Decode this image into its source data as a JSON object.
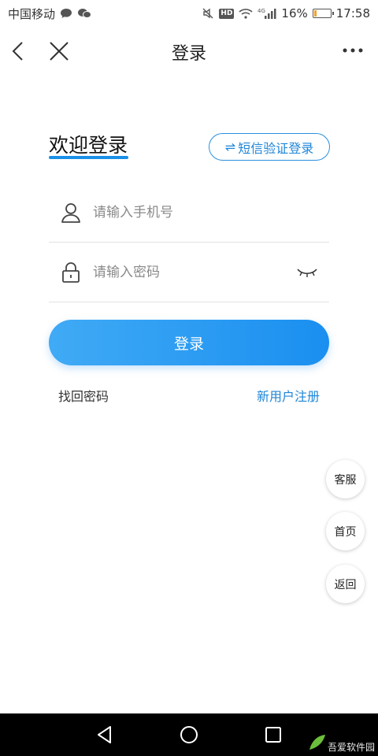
{
  "status_bar": {
    "carrier": "中国移动",
    "icons": [
      "chat-bubble-icon",
      "wechat-icon",
      "mute-icon",
      "hd-icon",
      "wifi-icon",
      "signal-icon",
      "battery-icon"
    ],
    "hd_label": "HD",
    "network": "4G",
    "battery_percent": "16%",
    "battery_level": 0.16,
    "time": "17:58"
  },
  "nav": {
    "title": "登录",
    "back_icon": "chevron-left-icon",
    "close_icon": "close-icon",
    "more_icon": "more-dots-icon"
  },
  "welcome": {
    "title": "欢迎登录",
    "sms_switch_icon": "⇌",
    "sms_switch_label": "短信验证登录"
  },
  "form": {
    "phone_placeholder": "请输入手机号",
    "phone_value": "",
    "password_placeholder": "请输入密码",
    "password_value": "",
    "login_button": "登录",
    "forgot_password": "找回密码",
    "register": "新用户注册"
  },
  "floating": {
    "customer_service": "客服",
    "home": "首页",
    "back": "返回"
  },
  "watermark": {
    "text": "吾爱软件园"
  },
  "colors": {
    "accent": "#1a8fe8",
    "link": "#1f86d8",
    "button_gradient_start": "#40aaf5",
    "button_gradient_end": "#1a8ff0",
    "battery_low": "#f0a030"
  }
}
